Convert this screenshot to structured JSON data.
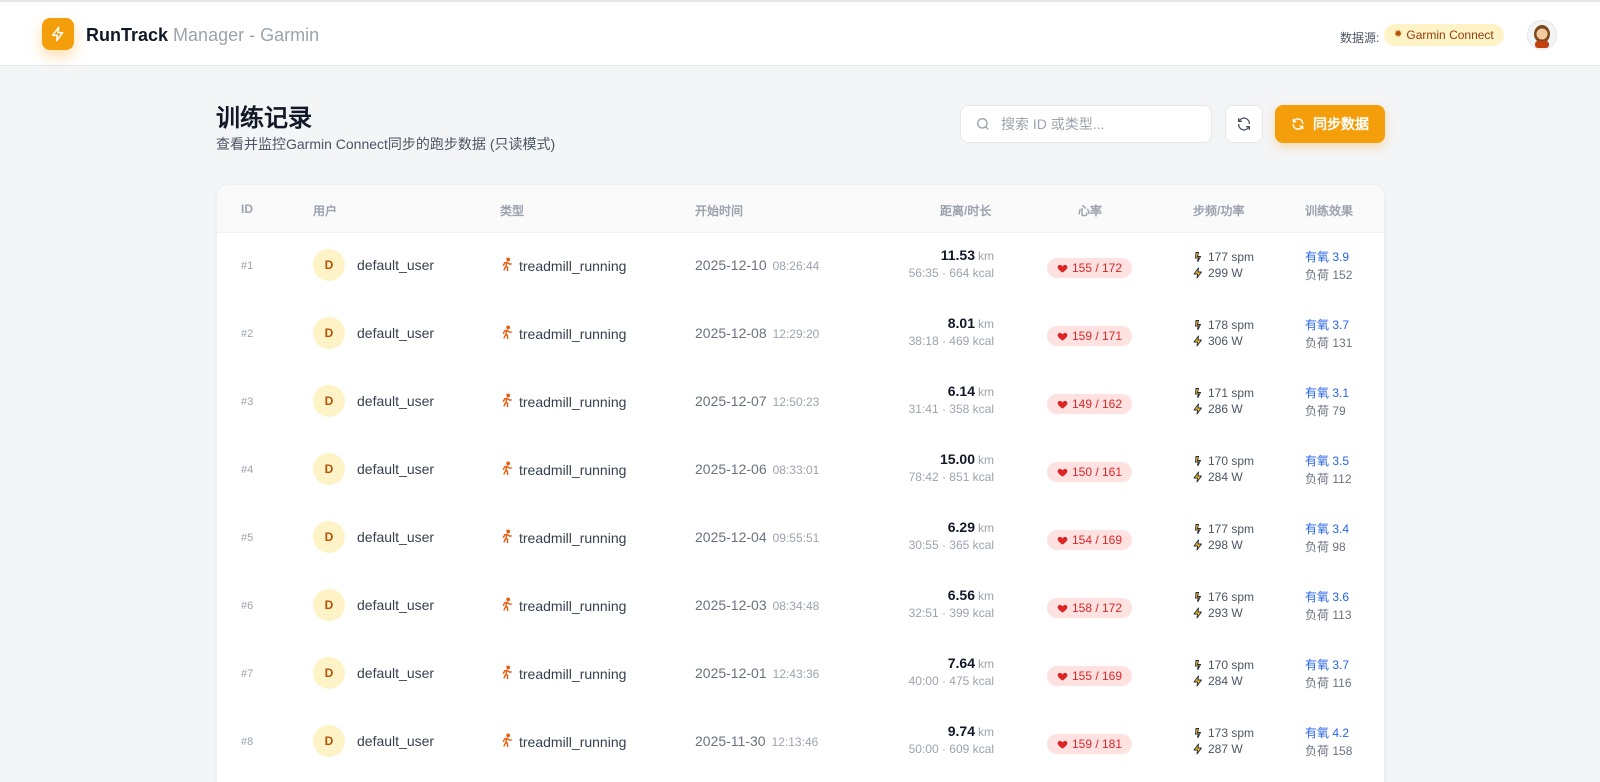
{
  "app": {
    "brand": "RunTrack",
    "subtitle": "Manager - Garmin",
    "source_label": "数据源:",
    "source_badge": "Garmin Connect",
    "accent_color": "#f59e0b"
  },
  "page": {
    "title": "训练记录",
    "subtitle": "查看并监控Garmin Connect同步的跑步数据 (只读模式)",
    "search_placeholder": "搜索 ID 或类型...",
    "sync_label": "同步数据"
  },
  "table": {
    "headers": {
      "id": "ID",
      "user": "用户",
      "type": "类型",
      "start": "开始时间",
      "dist": "距离/时长",
      "hr": "心率",
      "cad": "步频/功率",
      "eff": "训练效果"
    },
    "rows": [
      {
        "id": "#1",
        "avatar": "D",
        "user": "default_user",
        "type": "treadmill_running",
        "date": "2025-12-10",
        "time": "08:26:44",
        "km": "11.53",
        "unit": "km",
        "sub": "56:35 · 664 kcal",
        "hr": "155 / 172",
        "spm": "177 spm",
        "watt": "299 W",
        "aer_label": "有氧",
        "aer": "3.9",
        "load_label": "负荷",
        "load": "152"
      },
      {
        "id": "#2",
        "avatar": "D",
        "user": "default_user",
        "type": "treadmill_running",
        "date": "2025-12-08",
        "time": "12:29:20",
        "km": "8.01",
        "unit": "km",
        "sub": "38:18 · 469 kcal",
        "hr": "159 / 171",
        "spm": "178 spm",
        "watt": "306 W",
        "aer_label": "有氧",
        "aer": "3.7",
        "load_label": "负荷",
        "load": "131"
      },
      {
        "id": "#3",
        "avatar": "D",
        "user": "default_user",
        "type": "treadmill_running",
        "date": "2025-12-07",
        "time": "12:50:23",
        "km": "6.14",
        "unit": "km",
        "sub": "31:41 · 358 kcal",
        "hr": "149 / 162",
        "spm": "171 spm",
        "watt": "286 W",
        "aer_label": "有氧",
        "aer": "3.1",
        "load_label": "负荷",
        "load": "79"
      },
      {
        "id": "#4",
        "avatar": "D",
        "user": "default_user",
        "type": "treadmill_running",
        "date": "2025-12-06",
        "time": "08:33:01",
        "km": "15.00",
        "unit": "km",
        "sub": "78:42 · 851 kcal",
        "hr": "150 / 161",
        "spm": "170 spm",
        "watt": "284 W",
        "aer_label": "有氧",
        "aer": "3.5",
        "load_label": "负荷",
        "load": "112"
      },
      {
        "id": "#5",
        "avatar": "D",
        "user": "default_user",
        "type": "treadmill_running",
        "date": "2025-12-04",
        "time": "09:55:51",
        "km": "6.29",
        "unit": "km",
        "sub": "30:55 · 365 kcal",
        "hr": "154 / 169",
        "spm": "177 spm",
        "watt": "298 W",
        "aer_label": "有氧",
        "aer": "3.4",
        "load_label": "负荷",
        "load": "98"
      },
      {
        "id": "#6",
        "avatar": "D",
        "user": "default_user",
        "type": "treadmill_running",
        "date": "2025-12-03",
        "time": "08:34:48",
        "km": "6.56",
        "unit": "km",
        "sub": "32:51 · 399 kcal",
        "hr": "158 / 172",
        "spm": "176 spm",
        "watt": "293 W",
        "aer_label": "有氧",
        "aer": "3.6",
        "load_label": "负荷",
        "load": "113"
      },
      {
        "id": "#7",
        "avatar": "D",
        "user": "default_user",
        "type": "treadmill_running",
        "date": "2025-12-01",
        "time": "12:43:36",
        "km": "7.64",
        "unit": "km",
        "sub": "40:00 · 475 kcal",
        "hr": "155 / 169",
        "spm": "170 spm",
        "watt": "284 W",
        "aer_label": "有氧",
        "aer": "3.7",
        "load_label": "负荷",
        "load": "116"
      },
      {
        "id": "#8",
        "avatar": "D",
        "user": "default_user",
        "type": "treadmill_running",
        "date": "2025-11-30",
        "time": "12:13:46",
        "km": "9.74",
        "unit": "km",
        "sub": "50:00 · 609 kcal",
        "hr": "159 / 181",
        "spm": "173 spm",
        "watt": "287 W",
        "aer_label": "有氧",
        "aer": "4.2",
        "load_label": "负荷",
        "load": "158"
      }
    ]
  }
}
